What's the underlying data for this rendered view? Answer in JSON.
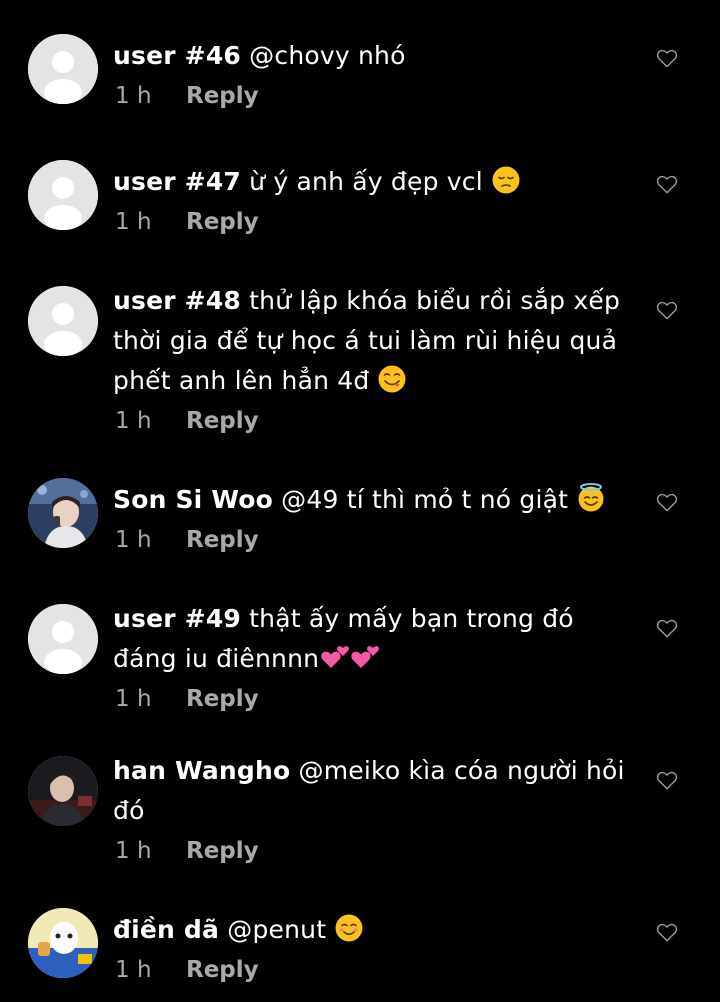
{
  "comments": [
    {
      "username": "user #46",
      "lines": [
        "@chovy nhó"
      ],
      "time": "1 h",
      "reply": "Reply",
      "avatar": "default-avatar"
    },
    {
      "username": "user #47",
      "lines": [
        "ừ ý anh ấy đẹp vcl"
      ],
      "time": "1 h",
      "reply": "Reply",
      "avatar": "default-avatar",
      "emoji": "pensive-face"
    },
    {
      "username": "user #48",
      "lines": [
        "thử lập khóa biểu rồi sắp xếp",
        "thời gia để tự học á tui làm rùi hiệu quả",
        "phết anh lên hẳn 4đ"
      ],
      "time": "1 h",
      "reply": "Reply",
      "avatar": "default-avatar",
      "emoji": "yum-face"
    },
    {
      "username": "Son Si Woo",
      "lines": [
        "@49 tí thì mỏ t nó giật"
      ],
      "time": "1 h",
      "reply": "Reply",
      "avatar": "photo-avatar",
      "emoji": "halo-face"
    },
    {
      "username": "user #49",
      "lines": [
        "thật ấy mấy bạn trong đó",
        "đáng iu điênnnn"
      ],
      "time": "1 h",
      "reply": "Reply",
      "avatar": "default-avatar",
      "emoji": "two-hearts"
    },
    {
      "username": "han Wangho",
      "lines": [
        "@meiko kìa cóa người hỏi",
        "đó"
      ],
      "time": "1 h",
      "reply": "Reply",
      "avatar": "photo-avatar"
    },
    {
      "username": "điền dã",
      "lines": [
        "@penut"
      ],
      "time": "1 h",
      "reply": "Reply",
      "avatar": "photo-avatar",
      "emoji": "smiling-face"
    }
  ],
  "colors": {
    "background": "#000000",
    "text": "#ffffff",
    "muted": "#a9a9a9",
    "avatar_default": "#e4e4e4",
    "heart_outline": "#9a9a9a"
  }
}
